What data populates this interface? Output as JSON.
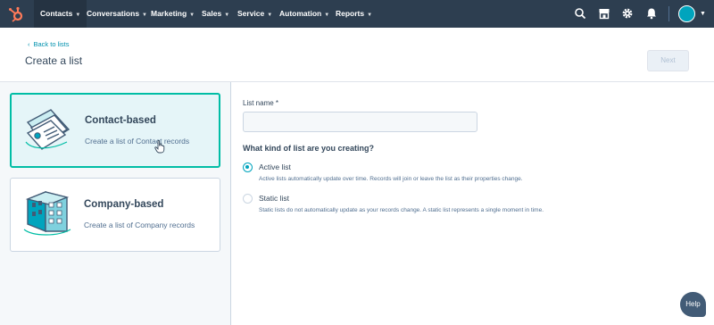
{
  "nav": {
    "items": [
      {
        "label": "Contacts",
        "active": true
      },
      {
        "label": "Conversations",
        "active": false
      },
      {
        "label": "Marketing",
        "active": false
      },
      {
        "label": "Sales",
        "active": false
      },
      {
        "label": "Service",
        "active": false
      },
      {
        "label": "Automation",
        "active": false
      },
      {
        "label": "Reports",
        "active": false
      }
    ],
    "icons": [
      "search-icon",
      "marketplace-icon",
      "settings-icon",
      "notifications-icon"
    ],
    "colors": {
      "bar": "#2d3e50",
      "active": "#253342",
      "logo": "#ff7a59",
      "avatar": "#00a4bd"
    }
  },
  "header": {
    "back_link": "Back to lists",
    "title": "Create a list",
    "next_button": "Next"
  },
  "list_types": [
    {
      "title": "Contact-based",
      "description": "Create a list of Contact records",
      "selected": true
    },
    {
      "title": "Company-based",
      "description": "Create a list of Company records",
      "selected": false
    }
  ],
  "form": {
    "list_name_label": "List name *",
    "list_name_value": "",
    "question": "What kind of list are you creating?",
    "options": [
      {
        "label": "Active list",
        "description": "Active lists automatically update over time. Records will join or leave the list as their properties change.",
        "checked": true
      },
      {
        "label": "Static list",
        "description": "Static lists do not automatically update as your records change. A static list represents a single moment in time.",
        "checked": false
      }
    ]
  },
  "help_button": "Help"
}
